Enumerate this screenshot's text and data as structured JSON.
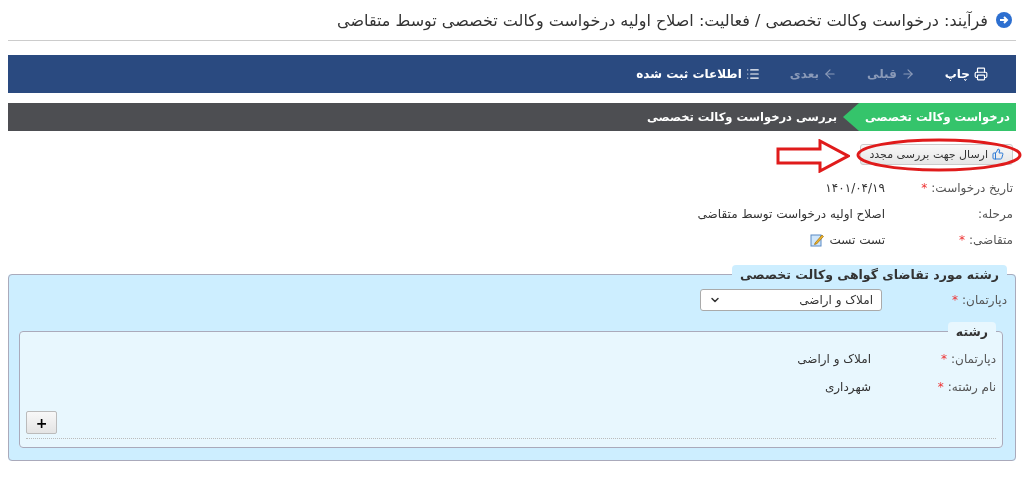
{
  "page_title": "فرآیند: درخواست وکالت تخصصی / فعالیت: اصلاح اولیه درخواست وکالت تخصصی توسط متقاضی",
  "toolbar": [
    {
      "kind": "print",
      "label": "چاپ",
      "disabled": false
    },
    {
      "kind": "previous",
      "label": "قبلی",
      "disabled": true
    },
    {
      "kind": "next",
      "label": "بعدی",
      "disabled": true
    },
    {
      "kind": "list",
      "label": "اطلاعات ثبت شده",
      "disabled": false
    }
  ],
  "steps": [
    {
      "label": "درخواست وکالت تخصصی",
      "selected": true
    },
    {
      "label": "بررسی درخواست وکالت تخصصی",
      "selected": false
    }
  ],
  "action_button": {
    "label": "ارسال جهت بررسی مجدد"
  },
  "fields": [
    {
      "kind": "text",
      "label": "تاریخ درخواست:",
      "required_mark": "*",
      "value": "۱۴۰۱/۰۴/۱۹"
    },
    {
      "kind": "text",
      "label": "مرحله:",
      "value": "اصلاح اولیه درخواست توسط متقاضی"
    },
    {
      "kind": "editable",
      "label": "متقاضی:",
      "required_mark": "*",
      "value": "تست تست"
    }
  ],
  "section": {
    "title": "رشته مورد تقاضای گواهی وکالت تخصصی",
    "department": {
      "label": "دپارتمان:",
      "required_mark": "*",
      "value": "املاک و اراضی"
    },
    "subsection": {
      "title": "رشته",
      "fields": [
        {
          "label": "دپارتمان:",
          "required_mark": "*",
          "value": "املاک و اراضی"
        },
        {
          "label": "نام رشته:",
          "required_mark": "*",
          "value": "شهرداری"
        }
      ],
      "add_button": "+"
    }
  }
}
